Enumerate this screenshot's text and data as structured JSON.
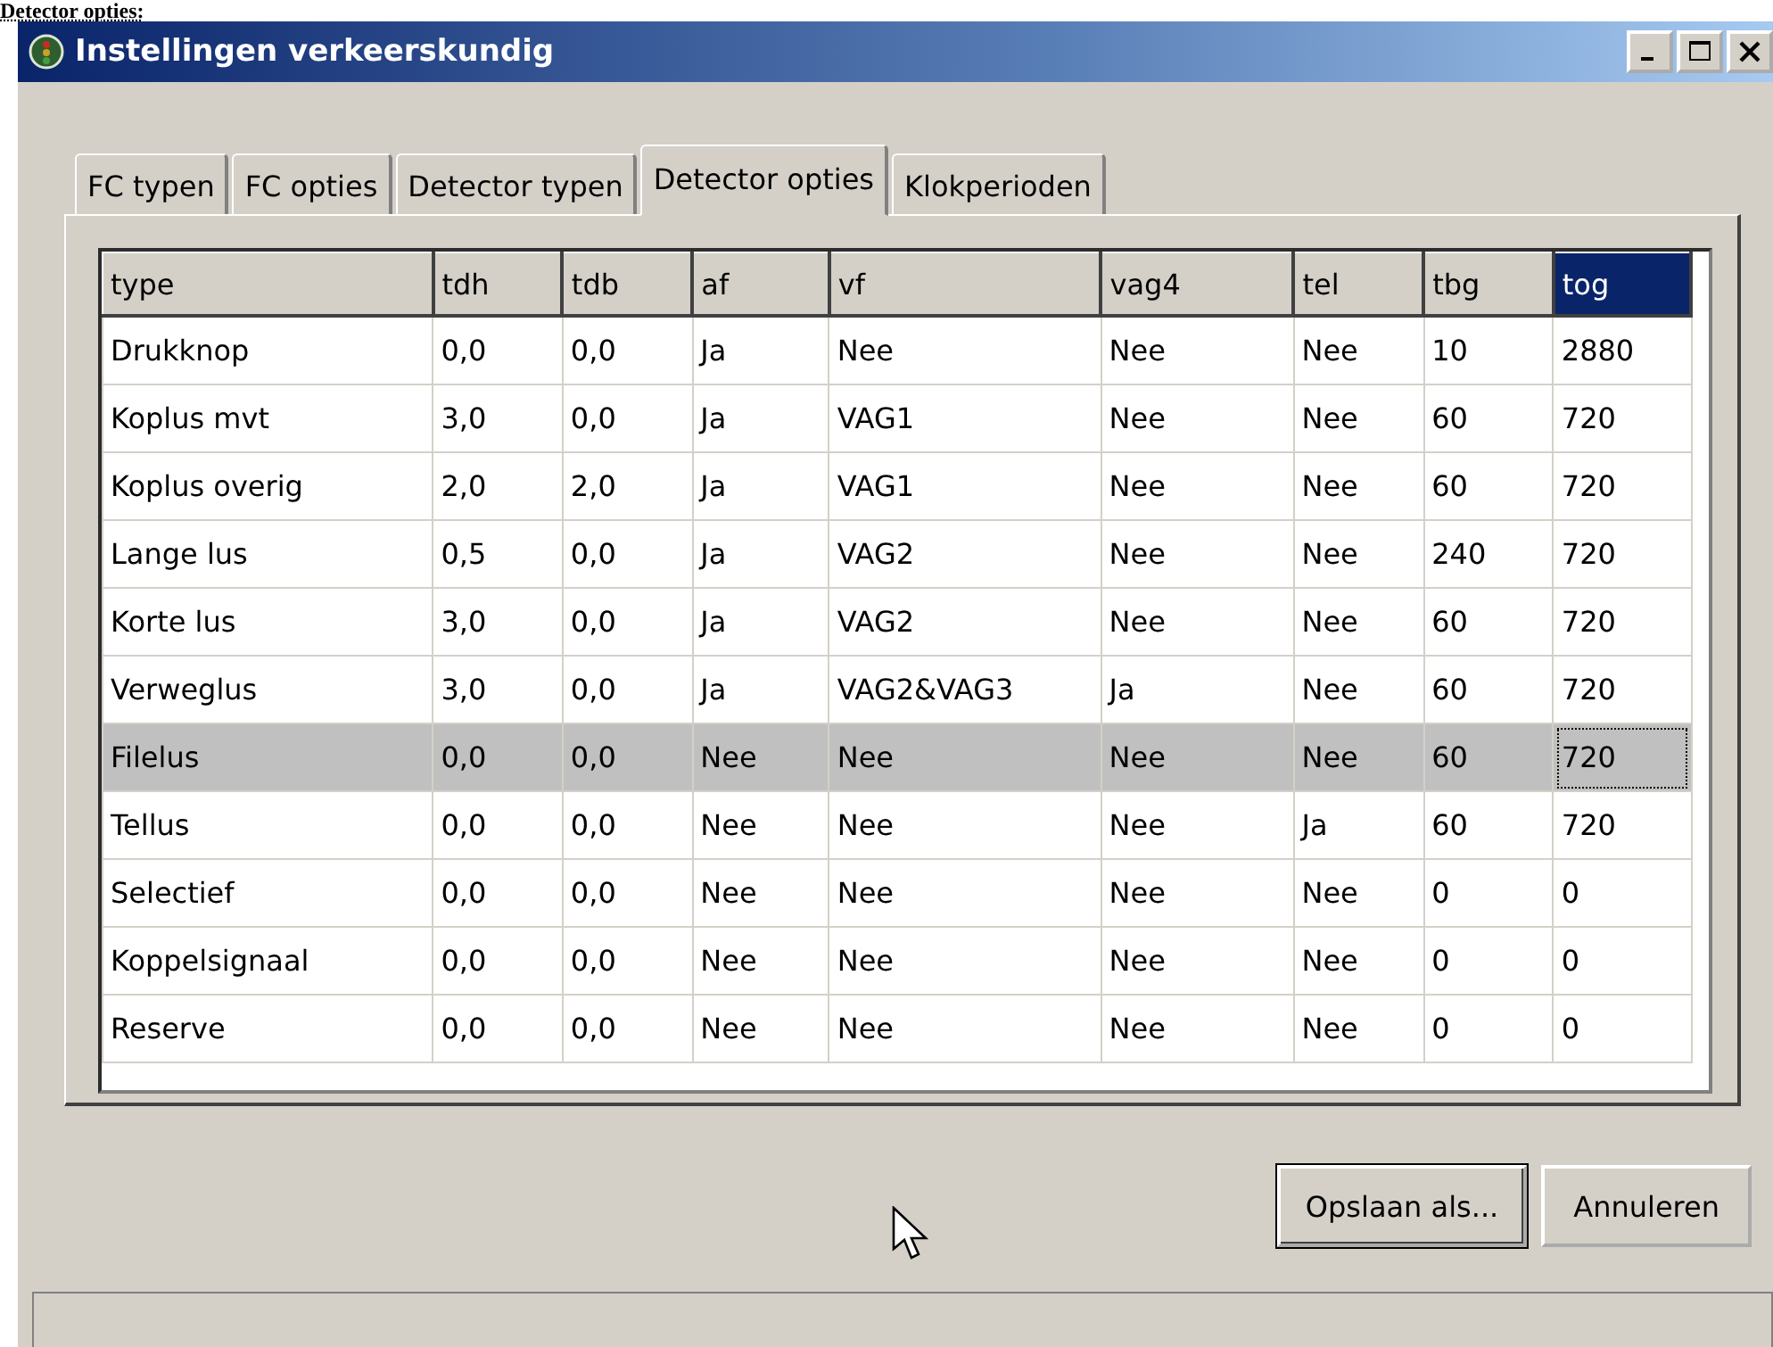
{
  "heading": "Detector opties:",
  "window": {
    "title": "Instellingen verkeerskundig"
  },
  "tabs": [
    {
      "label": "FC typen",
      "selected": false
    },
    {
      "label": "FC opties",
      "selected": false
    },
    {
      "label": "Detector typen",
      "selected": false
    },
    {
      "label": "Detector opties",
      "selected": true
    },
    {
      "label": "Klokperioden",
      "selected": false
    }
  ],
  "table": {
    "columns": [
      {
        "label": "type",
        "selected": false
      },
      {
        "label": "tdh",
        "selected": false
      },
      {
        "label": "tdb",
        "selected": false
      },
      {
        "label": "af",
        "selected": false
      },
      {
        "label": "vf",
        "selected": false
      },
      {
        "label": "vag4",
        "selected": false
      },
      {
        "label": "tel",
        "selected": false
      },
      {
        "label": "tbg",
        "selected": false
      },
      {
        "label": "tog",
        "selected": true
      }
    ],
    "rows": [
      {
        "selected": false,
        "cells": [
          "Drukknop",
          "0,0",
          "0,0",
          "Ja",
          "Nee",
          "Nee",
          "Nee",
          "10",
          "2880"
        ]
      },
      {
        "selected": false,
        "cells": [
          "Koplus mvt",
          "3,0",
          "0,0",
          "Ja",
          "VAG1",
          "Nee",
          "Nee",
          "60",
          "720"
        ]
      },
      {
        "selected": false,
        "cells": [
          "Koplus overig",
          "2,0",
          "2,0",
          "Ja",
          "VAG1",
          "Nee",
          "Nee",
          "60",
          "720"
        ]
      },
      {
        "selected": false,
        "cells": [
          "Lange lus",
          "0,5",
          "0,0",
          "Ja",
          "VAG2",
          "Nee",
          "Nee",
          "240",
          "720"
        ]
      },
      {
        "selected": false,
        "cells": [
          "Korte lus",
          "3,0",
          "0,0",
          "Ja",
          "VAG2",
          "Nee",
          "Nee",
          "60",
          "720"
        ]
      },
      {
        "selected": false,
        "cells": [
          "Verweglus",
          "3,0",
          "0,0",
          "Ja",
          "VAG2&VAG3",
          "Ja",
          "Nee",
          "60",
          "720"
        ]
      },
      {
        "selected": true,
        "cells": [
          "Filelus",
          "0,0",
          "0,0",
          "Nee",
          "Nee",
          "Nee",
          "Nee",
          "60",
          "720"
        ]
      },
      {
        "selected": false,
        "cells": [
          "Tellus",
          "0,0",
          "0,0",
          "Nee",
          "Nee",
          "Nee",
          "Ja",
          "60",
          "720"
        ]
      },
      {
        "selected": false,
        "cells": [
          "Selectief",
          "0,0",
          "0,0",
          "Nee",
          "Nee",
          "Nee",
          "Nee",
          "0",
          "0"
        ]
      },
      {
        "selected": false,
        "cells": [
          "Koppelsignaal",
          "0,0",
          "0,0",
          "Nee",
          "Nee",
          "Nee",
          "Nee",
          "0",
          "0"
        ]
      },
      {
        "selected": false,
        "cells": [
          "Reserve",
          "0,0",
          "0,0",
          "Nee",
          "Nee",
          "Nee",
          "Nee",
          "0",
          "0"
        ]
      }
    ]
  },
  "buttons": [
    {
      "label": "Opslaan als...",
      "default": true
    },
    {
      "label": "Annuleren",
      "default": false
    }
  ]
}
